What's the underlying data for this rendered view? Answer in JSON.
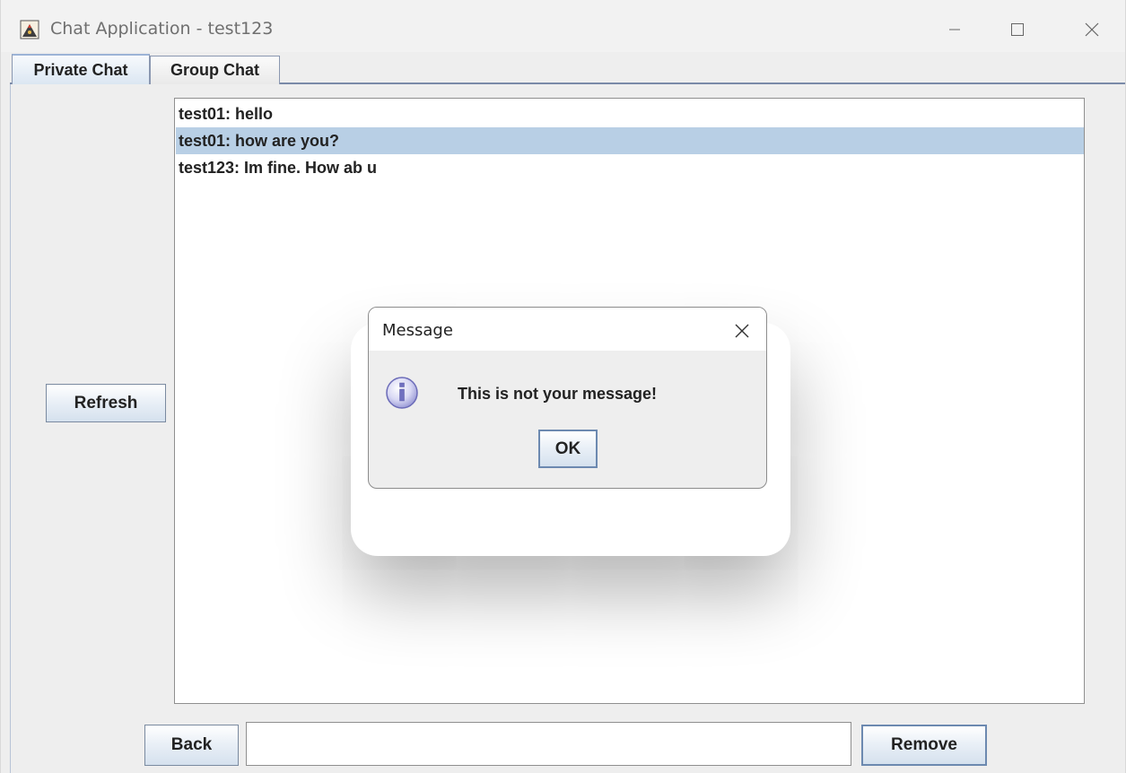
{
  "window": {
    "title": "Chat Application - test123"
  },
  "tabs": [
    {
      "label": "Private Chat",
      "selected": true
    },
    {
      "label": "Group Chat",
      "selected": false
    }
  ],
  "messages": [
    {
      "text": "test01: hello",
      "selected": false
    },
    {
      "text": "test01: how are you?",
      "selected": true
    },
    {
      "text": "test123: Im fine. How ab u",
      "selected": false
    }
  ],
  "buttons": {
    "refresh": "Refresh",
    "back": "Back",
    "remove": "Remove"
  },
  "input": {
    "value": ""
  },
  "dialog": {
    "title": "Message",
    "message": "This is not your message!",
    "ok_label": "OK",
    "icon": "info-icon"
  },
  "colors": {
    "selection": "#b8cfe5",
    "tab_accent": "#9cb4d6"
  }
}
